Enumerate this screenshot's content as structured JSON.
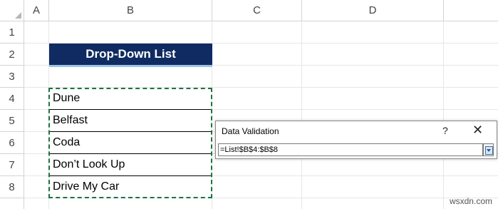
{
  "columns": [
    "A",
    "B",
    "C",
    "D"
  ],
  "rows": [
    "1",
    "2",
    "3",
    "4",
    "5",
    "6",
    "7",
    "8"
  ],
  "title": "Drop-Down List",
  "list_items": [
    "Dune",
    "Belfast",
    "Coda",
    "Don’t Look Up",
    "Drive My Car"
  ],
  "dialog": {
    "title": "Data Validation",
    "help_label": "?",
    "close_label": "✕",
    "formula": "=List!$B$4:$B$8",
    "collapse_icon": "collapse-dialog-icon"
  },
  "watermark": "wsxdn.com",
  "colors": {
    "title_bg": "#0f2b61",
    "title_underline": "#9dc3e6",
    "marquee": "#1e7145"
  }
}
